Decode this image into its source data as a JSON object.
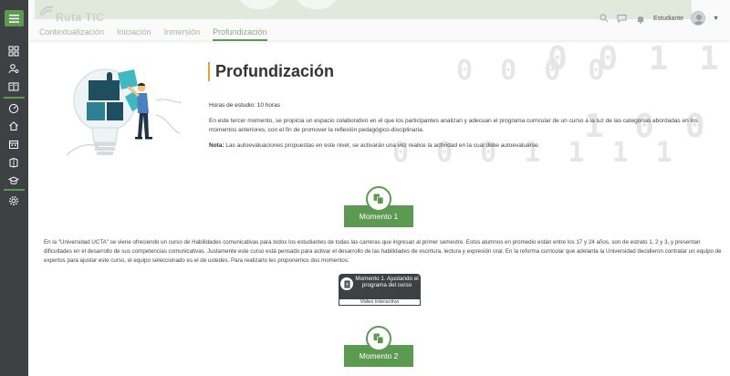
{
  "header": {
    "brand": "Ruta TIC",
    "tabs": [
      {
        "label": "Contextualización"
      },
      {
        "label": "Iniciación"
      },
      {
        "label": "Inmersión"
      },
      {
        "label": "Profundización"
      }
    ],
    "user_label": "Estudiante",
    "active_tab_index": 3
  },
  "sidebar": {
    "items": [
      {
        "icon": "dashboard-icon"
      },
      {
        "icon": "user-search-icon"
      },
      {
        "icon": "book-icon"
      },
      {
        "icon": "gauge-icon"
      },
      {
        "icon": "home-icon"
      },
      {
        "icon": "calendar-icon"
      },
      {
        "icon": "library-icon"
      },
      {
        "icon": "graduation-cap-icon"
      },
      {
        "icon": "gear-icon"
      }
    ]
  },
  "main": {
    "title": "Profundización",
    "hours": "Horas de estudio: 10 horas",
    "intro": "En este tercer momento, se propicia un espacio colaborativo en el que los participantes analizan y adecuan el programa curricular de un curso a la luz de las categorías abordadas en los momentos anteriores, con el fin de promover la reflexión pedagógico-disciplinaria.",
    "note_label": "Nota:",
    "note_text": " Las autoevaluaciones propuestas en este nivel, se activarán una vez realice la actividad en la cual debe autoevaluarse.",
    "moment1_label": "Momento 1",
    "case_text": "En la \"Universidad UCTA\" se viene ofreciendo un curso de Habilidades comunicativas para todos los estudiantes de todas las carreras que ingresan al primer semestre. Estos alumnos en promedio están entre los 17 y 24 años, son de estrato 1, 2 y 3, y presentan dificultades en el desarrollo de sus competencias comunicativas. Justamente este curso está pensado para activar el desarrollo de las habilidades de escritura, lectura y expresión oral. En la reforma curricular que adelanta la Universidad decidieron contratar un equipo de expertos para ajustar este curso, el equipo seleccionado es el de ustedes. Para realizarlo les proponemos dos momentos:",
    "activity_title": "Momento 1. Ajustando el programa del curso",
    "activity_sub": "Video interactivo",
    "moment2_label": "Momento 2"
  },
  "colors": {
    "accent_green": "#5c9a52",
    "sidebar_dark": "#3d4144",
    "title_bar_orange": "#e5a13a"
  }
}
